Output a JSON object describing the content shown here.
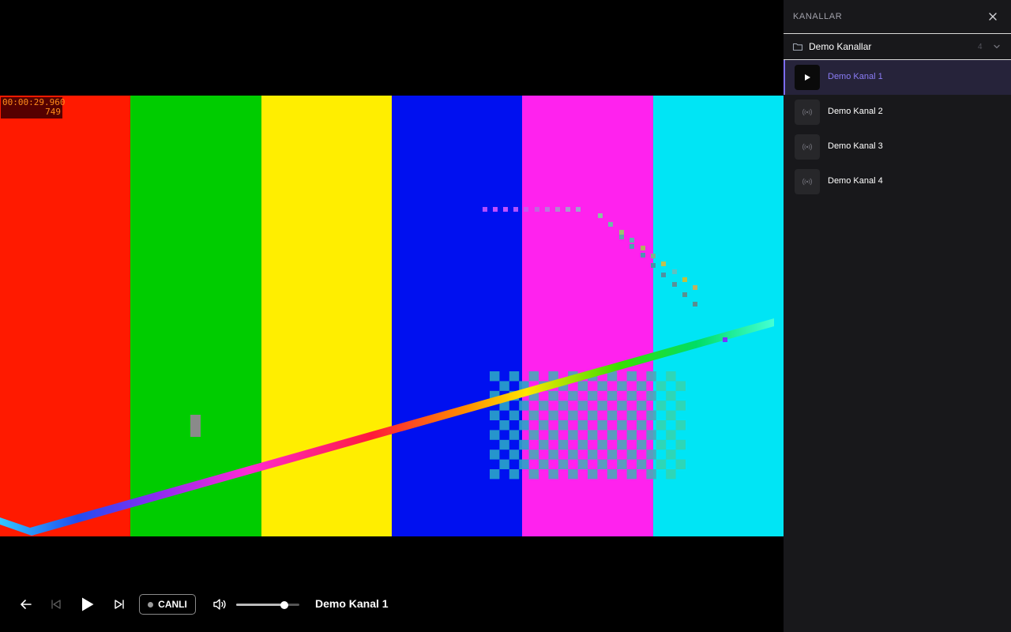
{
  "video": {
    "timecode": "00:00:29.960",
    "frame": "749",
    "color_bars": [
      "#ff1a00",
      "#00cc00",
      "#ffee00",
      "#0010f0",
      "#ff22ee",
      "#00e5f5"
    ]
  },
  "controls": {
    "live_label": "CANLI",
    "volume_level": 0.76,
    "now_playing": "Demo Kanal 1"
  },
  "sidebar": {
    "title": "KANALLAR",
    "folder": {
      "label": "Demo Kanallar",
      "count": "4"
    },
    "channels": [
      {
        "label": "Demo Kanal 1",
        "active": true,
        "icon": "play-icon"
      },
      {
        "label": "Demo Kanal 2",
        "active": false,
        "icon": "broadcast-icon"
      },
      {
        "label": "Demo Kanal 3",
        "active": false,
        "icon": "broadcast-icon"
      },
      {
        "label": "Demo Kanal 4",
        "active": false,
        "icon": "broadcast-icon"
      }
    ]
  },
  "colors": {
    "accent": "#8b7cf6",
    "sidebar_bg": "#18181b",
    "timecode_fg": "#ff8c1a",
    "timecode_bg": "#550000"
  }
}
